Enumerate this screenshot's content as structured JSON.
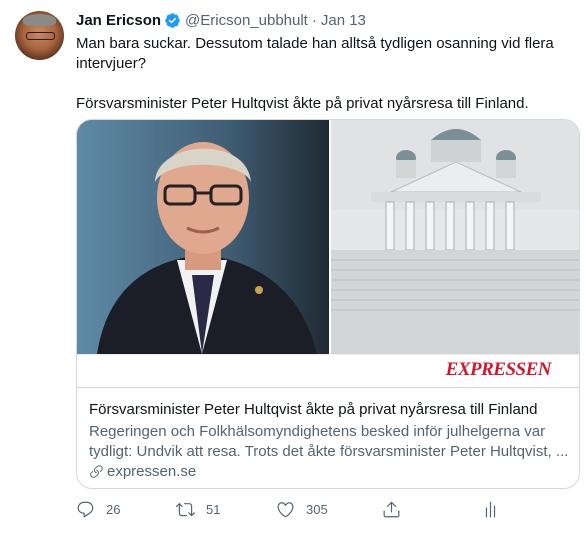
{
  "tweet": {
    "author_name": "Jan Ericson",
    "author_handle": "@Ericson_ubbhult",
    "separator": "·",
    "date": "Jan 13",
    "text_line1": "Man bara suckar. Dessutom talade han alltså tydligen osanning vid flera intervjuer?",
    "text_line2": "Försvarsminister Peter Hultqvist åkte på privat nyårsresa till Finland."
  },
  "card": {
    "logo_text": "EXPRESSEN",
    "title": "Försvarsminister Peter Hultqvist åkte på privat nyårsresa till Finland",
    "description": "Regeringen och Folkhälsomyndighetens besked inför julhelgerna var tydligt: Undvik att resa. Trots det åkte försvarsminister Peter Hultqvist, ...",
    "domain": "expressen.se"
  },
  "actions": {
    "replies": "26",
    "retweets": "51",
    "likes": "305"
  },
  "colors": {
    "verified": "#1d9bf0",
    "secondary_text": "#536471",
    "brand_red": "#d6142a"
  },
  "icons": [
    "verified-icon",
    "link-icon",
    "reply-icon",
    "retweet-icon",
    "like-icon",
    "share-icon",
    "analytics-icon"
  ]
}
